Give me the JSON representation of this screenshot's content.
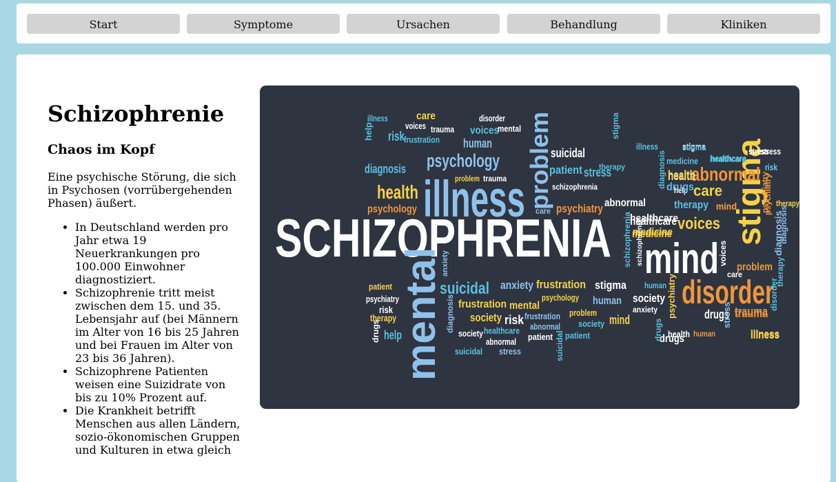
{
  "nav": {
    "items": [
      {
        "label": "Start"
      },
      {
        "label": "Symptome"
      },
      {
        "label": "Ursachen"
      },
      {
        "label": "Behandlung"
      },
      {
        "label": "Kliniken"
      }
    ]
  },
  "main": {
    "title": "Schizophrenie",
    "subtitle": "Chaos im Kopf",
    "intro": "Eine psychische Störung, die sich in Psychosen (vorrübergehenden Phasen) äußert.",
    "facts": [
      "In Deutschland werden pro Jahr etwa 19 Neuerkrankungen pro 100.000 Einwohner diagnostiziert.",
      "Schizophrenie tritt meist zwischen dem 15. und 35. Lebensjahr auf (bei Männern im Alter von 16 bis 25 Jahren und bei Frauen im Alter von 23 bis 36 Jahren).",
      "Schizophrene Patienten weisen eine Suizidrate von bis zu 10% Prozent auf.",
      "Die Krankheit betrifft Menschen aus allen Ländern, sozio-ökonomischen Gruppen und Kulturen in etwa gleich"
    ]
  },
  "wordcloud": {
    "background": "#2e3440",
    "words": [
      {
        "text": "SCHIZOPHRENIA",
        "color": "#ffffff"
      },
      {
        "text": "mental",
        "color": "#8fc1ea"
      },
      {
        "text": "illness",
        "color": "#8fc1ea"
      },
      {
        "text": "problem",
        "color": "#8fc1ea"
      },
      {
        "text": "psychology",
        "color": "#8fc1ea"
      },
      {
        "text": "mind",
        "color": "#ffffff"
      },
      {
        "text": "stigma",
        "color": "#f5d24a"
      },
      {
        "text": "disorder",
        "color": "#f0963c"
      },
      {
        "text": "abnormal",
        "color": "#f0963c"
      },
      {
        "text": "care",
        "color": "#f5d24a"
      },
      {
        "text": "voices",
        "color": "#f5d24a"
      },
      {
        "text": "health",
        "color": "#f5d24a"
      },
      {
        "text": "psychology",
        "color": "#f0963c"
      },
      {
        "text": "suicidal",
        "color": "#5bc0de"
      },
      {
        "text": "anxiety",
        "color": "#8fc1ea"
      },
      {
        "text": "frustration",
        "color": "#f5d24a"
      },
      {
        "text": "stigma",
        "color": "#ffffff"
      },
      {
        "text": "human",
        "color": "#8fc1ea"
      },
      {
        "text": "society",
        "color": "#ffffff"
      },
      {
        "text": "drugs",
        "color": "#ffffff"
      },
      {
        "text": "trauma",
        "color": "#f0963c"
      },
      {
        "text": "illness",
        "color": "#f5d24a"
      },
      {
        "text": "frustration",
        "color": "#f5d24a"
      },
      {
        "text": "mental",
        "color": "#f5d24a"
      },
      {
        "text": "society",
        "color": "#f5d24a"
      },
      {
        "text": "risk",
        "color": "#ffffff"
      },
      {
        "text": "mind",
        "color": "#f5d24a"
      },
      {
        "text": "medicine",
        "color": "#f5d24a"
      },
      {
        "text": "healthcare",
        "color": "#ffffff"
      },
      {
        "text": "therapy",
        "color": "#5bc0de"
      },
      {
        "text": "psychiatry",
        "color": "#f0963c"
      },
      {
        "text": "abnormal",
        "color": "#ffffff"
      },
      {
        "text": "suicidal",
        "color": "#ffffff"
      },
      {
        "text": "patient",
        "color": "#5bc0de"
      },
      {
        "text": "stress",
        "color": "#5bc0de"
      },
      {
        "text": "health",
        "color": "#ffffff"
      },
      {
        "text": "diagnosis",
        "color": "#5bc0de"
      },
      {
        "text": "risk",
        "color": "#5bc0de"
      },
      {
        "text": "human",
        "color": "#8fc1ea"
      },
      {
        "text": "voices",
        "color": "#5bc0de"
      },
      {
        "text": "care",
        "color": "#f5d24a"
      },
      {
        "text": "illness",
        "color": "#5bc0de"
      },
      {
        "text": "help",
        "color": "#5bc0de"
      },
      {
        "text": "voices",
        "color": "#ffffff"
      },
      {
        "text": "trauma",
        "color": "#ffffff"
      },
      {
        "text": "frustration",
        "color": "#5bc0de"
      },
      {
        "text": "disorder",
        "color": "#ffffff"
      },
      {
        "text": "mental",
        "color": "#ffffff"
      },
      {
        "text": "stigma",
        "color": "#ffffff"
      },
      {
        "text": "stress",
        "color": "#ffffff"
      },
      {
        "text": "healthcare",
        "color": "#5bc0de"
      },
      {
        "text": "medicine",
        "color": "#5bc0de"
      },
      {
        "text": "risk",
        "color": "#5bc0de"
      },
      {
        "text": "psychiatry",
        "color": "#f0963c"
      },
      {
        "text": "diagnosis",
        "color": "#8fc1ea"
      },
      {
        "text": "therapy",
        "color": "#5bc0de"
      },
      {
        "text": "mind",
        "color": "#f0963c"
      },
      {
        "text": "schizophrenia",
        "color": "#ffffff"
      },
      {
        "text": "help",
        "color": "#ffffff"
      },
      {
        "text": "problem",
        "color": "#f5d24a"
      },
      {
        "text": "trauma",
        "color": "#ffffff"
      },
      {
        "text": "care",
        "color": "#8fc1ea"
      },
      {
        "text": "patient",
        "color": "#f5d24a"
      },
      {
        "text": "psychiatry",
        "color": "#ffffff"
      },
      {
        "text": "risk",
        "color": "#ffffff"
      },
      {
        "text": "therapy",
        "color": "#f5d24a"
      },
      {
        "text": "help",
        "color": "#5bc0de"
      },
      {
        "text": "drugs",
        "color": "#ffffff"
      },
      {
        "text": "diagnosis",
        "color": "#8fc1ea"
      },
      {
        "text": "anxiety",
        "color": "#8fc1ea"
      },
      {
        "text": "society",
        "color": "#ffffff"
      },
      {
        "text": "healthcare",
        "color": "#5bc0de"
      },
      {
        "text": "abnormal",
        "color": "#ffffff"
      },
      {
        "text": "suicidal",
        "color": "#5bc0de"
      },
      {
        "text": "stress",
        "color": "#8fc1ea"
      },
      {
        "text": "frustration",
        "color": "#8fc1ea"
      },
      {
        "text": "abnormal",
        "color": "#8fc1ea"
      },
      {
        "text": "patient",
        "color": "#ffffff"
      },
      {
        "text": "problem",
        "color": "#f5d24a"
      },
      {
        "text": "psychology",
        "color": "#f5d24a"
      },
      {
        "text": "society",
        "color": "#5bc0de"
      },
      {
        "text": "patient",
        "color": "#5bc0de"
      },
      {
        "text": "suicidal",
        "color": "#5bc0de"
      },
      {
        "text": "schizophrenia",
        "color": "#5bc0de"
      },
      {
        "text": "schizophrenia",
        "color": "#ffffff"
      },
      {
        "text": "healthcare",
        "color": "#ffffff"
      },
      {
        "text": "medicine",
        "color": "#f5d24a"
      },
      {
        "text": "human",
        "color": "#5bc0de"
      },
      {
        "text": "anxiety",
        "color": "#ffffff"
      },
      {
        "text": "psychiatry",
        "color": "#f5d24a"
      },
      {
        "text": "drugs",
        "color": "#ffffff"
      },
      {
        "text": "stress",
        "color": "#8fc1ea"
      },
      {
        "text": "trauma",
        "color": "#f0963c"
      },
      {
        "text": "illness",
        "color": "#f5d24a"
      },
      {
        "text": "health",
        "color": "#ffffff"
      },
      {
        "text": "human",
        "color": "#f0963c"
      },
      {
        "text": "drugs",
        "color": "#5bc0de"
      },
      {
        "text": "voices",
        "color": "#ffffff"
      },
      {
        "text": "care",
        "color": "#ffffff"
      },
      {
        "text": "problem",
        "color": "#f0963c"
      },
      {
        "text": "diagnosis",
        "color": "#8fc1ea"
      },
      {
        "text": "psychiatry",
        "color": "#f0963c"
      },
      {
        "text": "therapy",
        "color": "#f5d24a"
      },
      {
        "text": "disorder",
        "color": "#5bc0de"
      },
      {
        "text": "risk",
        "color": "#5bc0de"
      },
      {
        "text": "healthcare",
        "color": "#5bc0de"
      },
      {
        "text": "stress",
        "color": "#ffffff"
      },
      {
        "text": "stigma",
        "color": "#5bc0de"
      },
      {
        "text": "illness",
        "color": "#5bc0de"
      },
      {
        "text": "mind",
        "color": "#f0963c"
      },
      {
        "text": "health",
        "color": "#f5d24a"
      },
      {
        "text": "stigma",
        "color": "#5bc0de"
      },
      {
        "text": "drugs",
        "color": "#5bc0de"
      },
      {
        "text": "therapy",
        "color": "#5bc0de"
      },
      {
        "text": "diagnosis",
        "color": "#5bc0de"
      }
    ]
  }
}
